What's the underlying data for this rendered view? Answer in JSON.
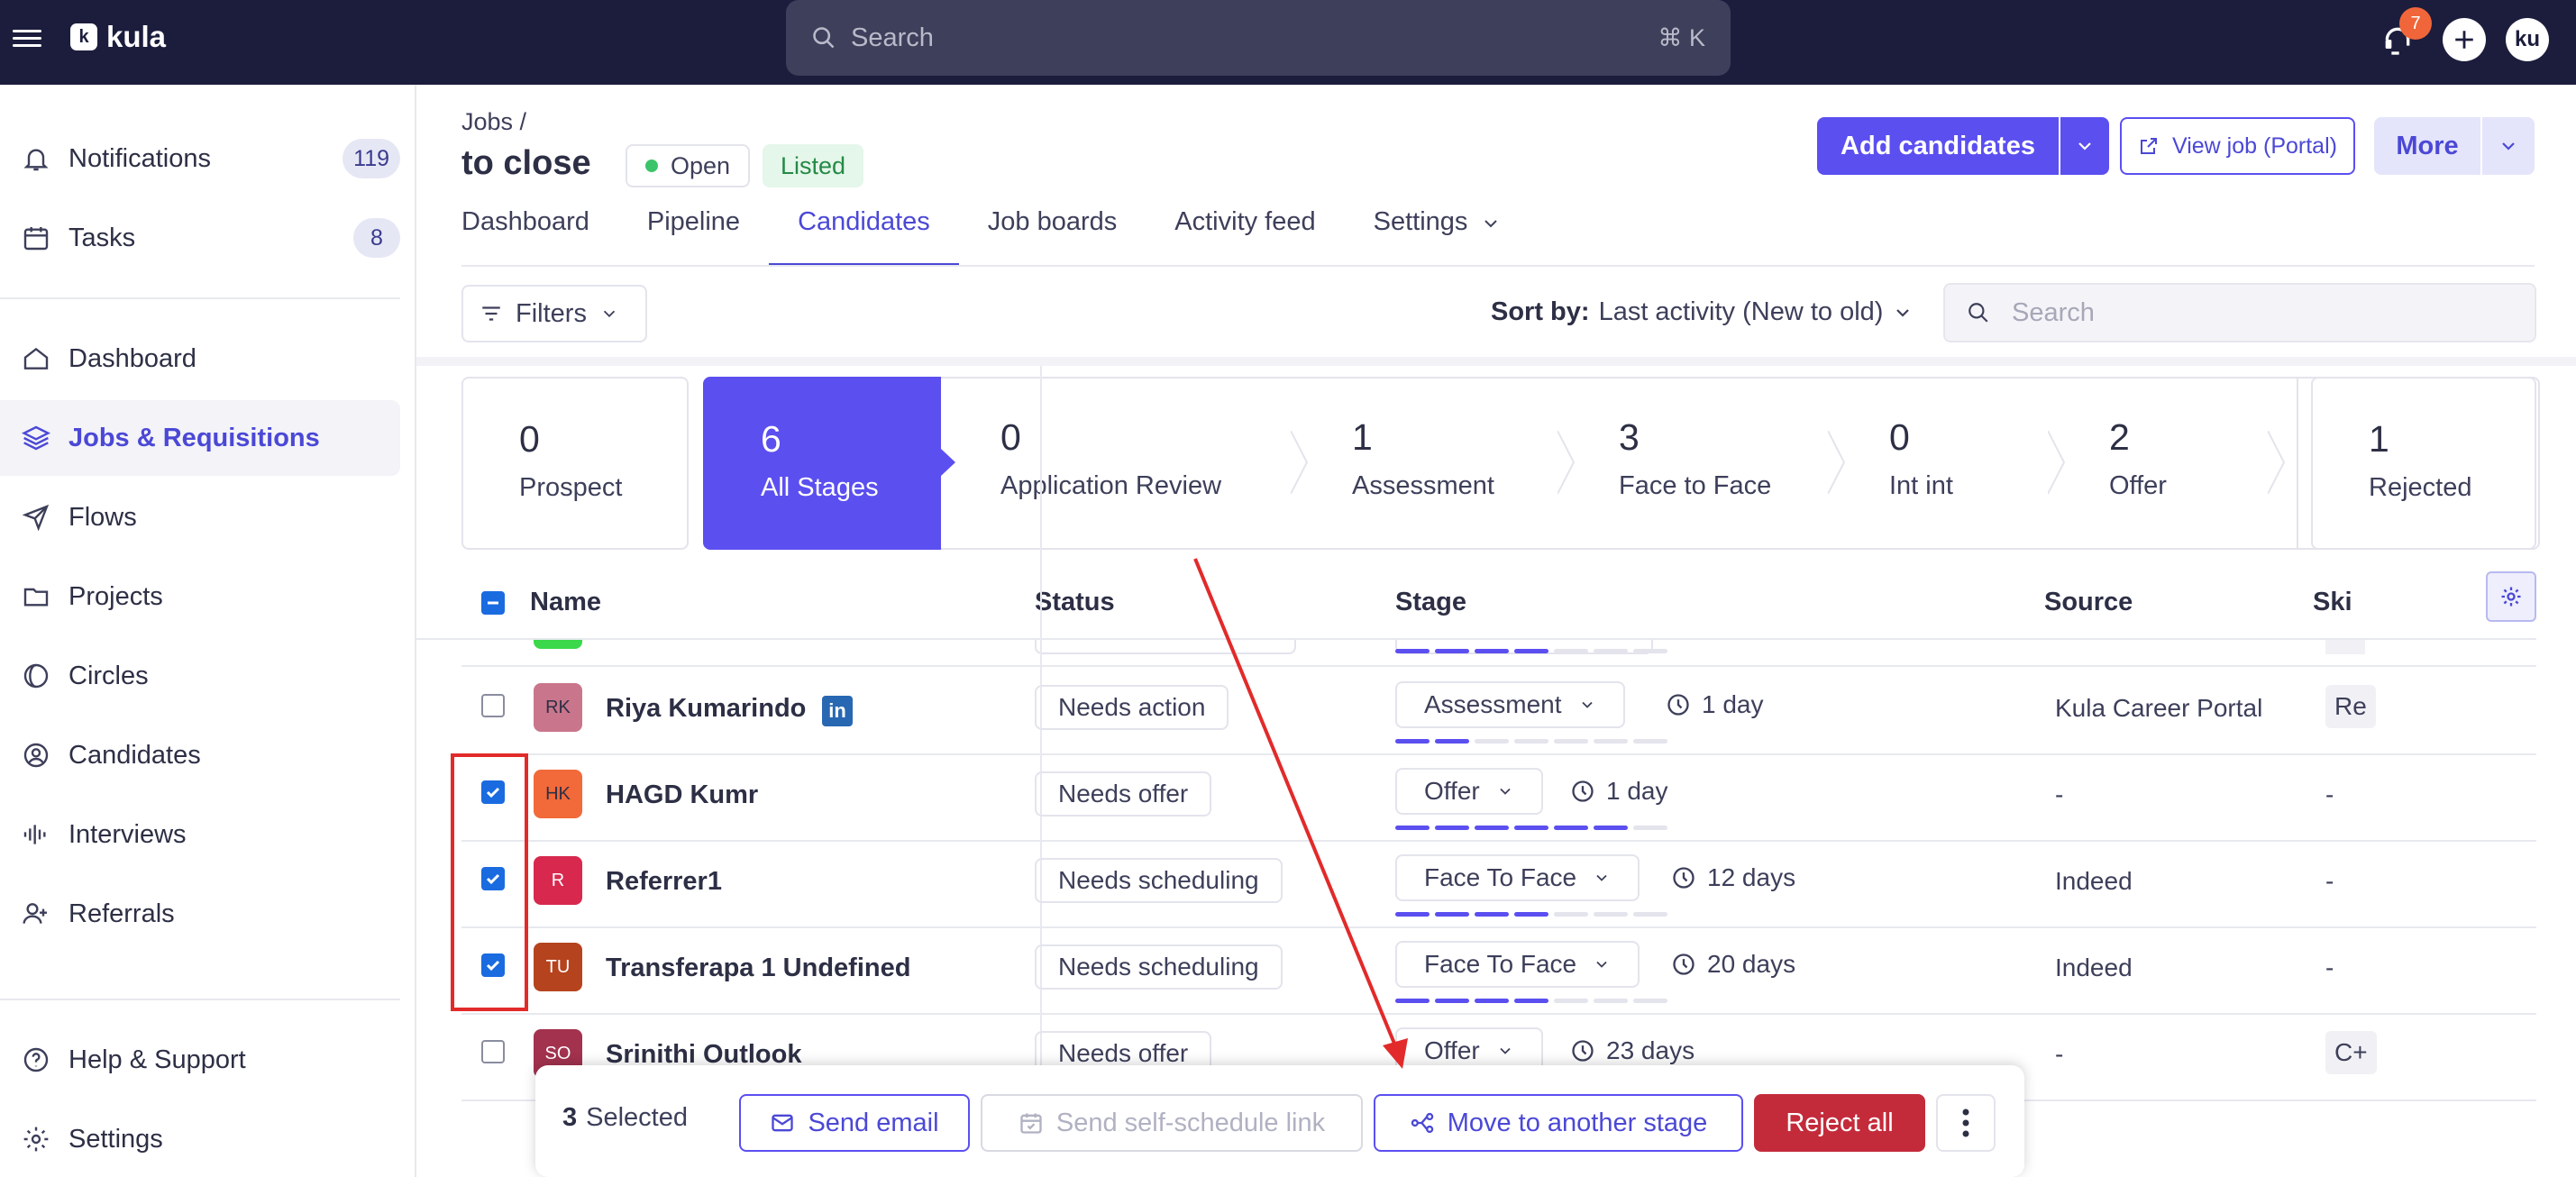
{
  "topbar": {
    "brand": "kula",
    "brand_mark": "k",
    "search_placeholder": "Search",
    "search_shortcut": "⌘ K",
    "notification_count": "7",
    "user_initials": "ku"
  },
  "sidebar": {
    "items": [
      {
        "label": "Notifications",
        "badge": "119",
        "icon": "bell-icon"
      },
      {
        "label": "Tasks",
        "badge": "8",
        "icon": "calendar-icon"
      },
      {
        "label": "Dashboard",
        "icon": "home-icon"
      },
      {
        "label": "Jobs & Requisitions",
        "icon": "layers-icon"
      },
      {
        "label": "Flows",
        "icon": "send-icon"
      },
      {
        "label": "Projects",
        "icon": "folder-icon"
      },
      {
        "label": "Circles",
        "icon": "circles-icon"
      },
      {
        "label": "Candidates",
        "icon": "user-circle-icon"
      },
      {
        "label": "Interviews",
        "icon": "waveform-icon"
      },
      {
        "label": "Referrals",
        "icon": "user-plus-icon"
      },
      {
        "label": "Help & Support",
        "icon": "help-icon"
      },
      {
        "label": "Settings",
        "icon": "gear-icon"
      }
    ]
  },
  "header": {
    "breadcrumb": "Jobs /",
    "title": "to close",
    "status_open": "Open",
    "status_listed": "Listed",
    "add_candidates": "Add candidates",
    "view_job": "View job (Portal)",
    "more": "More"
  },
  "tabs": [
    "Dashboard",
    "Pipeline",
    "Candidates",
    "Job boards",
    "Activity feed",
    "Settings"
  ],
  "toolbar": {
    "filters": "Filters",
    "sort_label": "Sort by:",
    "sort_value": "Last activity (New to old)",
    "search_placeholder": "Search"
  },
  "stages": [
    {
      "count": "0",
      "label": "Prospect"
    },
    {
      "count": "6",
      "label": "All Stages"
    },
    {
      "count": "0",
      "label": "Application Review"
    },
    {
      "count": "1",
      "label": "Assessment"
    },
    {
      "count": "3",
      "label": "Face to Face"
    },
    {
      "count": "0",
      "label": "Int int"
    },
    {
      "count": "2",
      "label": "Offer"
    },
    {
      "count": "1",
      "label": "Rejected"
    }
  ],
  "table": {
    "columns": [
      "Name",
      "Status",
      "Stage",
      "Source",
      "Ski"
    ],
    "rows": [
      {
        "initials": "RK",
        "name": "Riya Kumarindo",
        "status": "Needs action",
        "stage": "Assessment",
        "duration": "1 day",
        "source": "Kula Career Portal",
        "skill": "Re",
        "checked": false,
        "linkedin": true,
        "avatar_color": "#c9768c"
      },
      {
        "initials": "HK",
        "name": "HAGD Kumr",
        "status": "Needs offer",
        "stage": "Offer",
        "duration": "1 day",
        "source": "-",
        "skill": "-",
        "checked": true,
        "avatar_color": "#f2693a"
      },
      {
        "initials": "R",
        "name": "Referrer1",
        "status": "Needs scheduling",
        "stage": "Face To Face",
        "duration": "12 days",
        "source": "Indeed",
        "skill": "-",
        "checked": true,
        "avatar_color": "#d8284e"
      },
      {
        "initials": "TU",
        "name": "Transferapa 1 Undefined",
        "status": "Needs scheduling",
        "stage": "Face To Face",
        "duration": "20 days",
        "source": "Indeed",
        "skill": "-",
        "checked": true,
        "avatar_color": "#b5431e"
      },
      {
        "initials": "SO",
        "name": "Srinithi Outlook",
        "status": "Needs offer",
        "stage": "Offer",
        "duration": "23 days",
        "source": "-",
        "skill": "C+",
        "checked": false,
        "avatar_color": "#a3324f"
      }
    ]
  },
  "bulk": {
    "count": "3",
    "selected_label": "Selected",
    "send_email": "Send email",
    "self_schedule": "Send self-schedule link",
    "move_stage": "Move to another stage",
    "reject_all": "Reject all"
  },
  "colors": {
    "accent": "#5b4ff0",
    "topbar": "#1c1d3d",
    "danger": "#c42b3a",
    "annotation": "#e22a2a"
  }
}
